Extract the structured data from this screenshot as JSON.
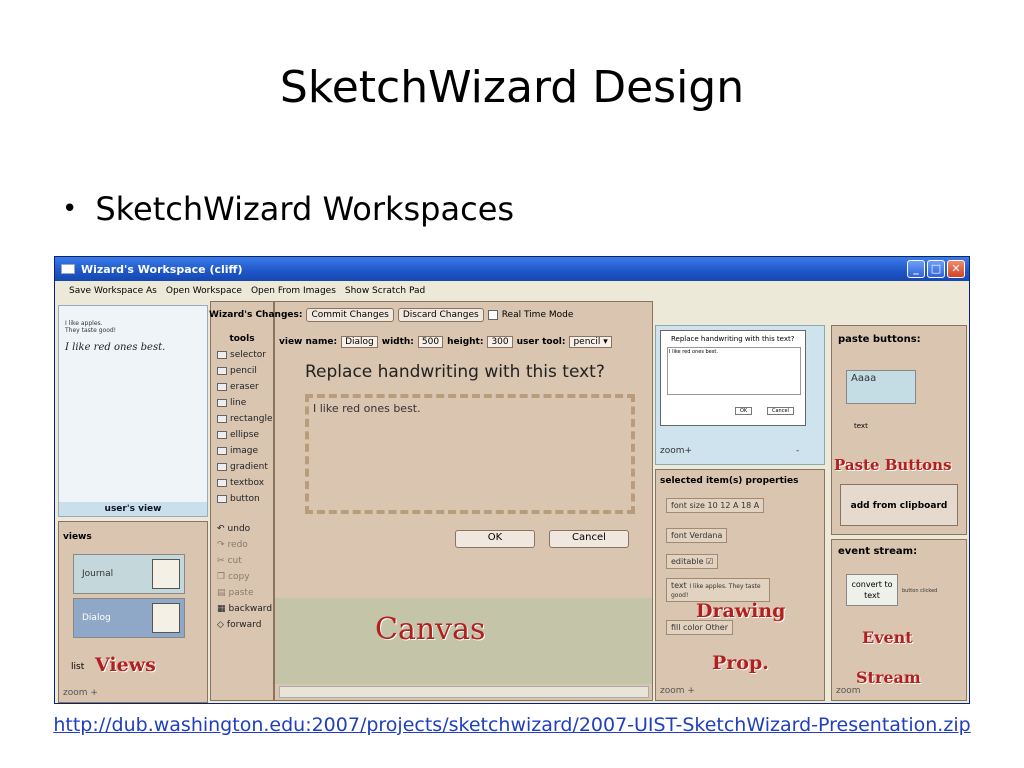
{
  "slide": {
    "title": "SketchWizard Design",
    "bullet": "SketchWizard Workspaces",
    "url": "http://dub.washington.edu:2007/projects/sketchwizard/2007-UIST-SketchWizard-Presentation.zip"
  },
  "window": {
    "title": "Wizard's Workspace (cliff)",
    "menu": [
      "Save Workspace As",
      "Open Workspace",
      "Open From Images",
      "Show Scratch Pad"
    ]
  },
  "users_view": {
    "typed_line1": "I like apples.",
    "typed_line2": "They taste good!",
    "handwriting": "I like red ones best.",
    "label": "user's view"
  },
  "views": {
    "heading": "views",
    "item1": "Journal",
    "item2": "Dialog",
    "tab": "list",
    "zoom": "zoom +",
    "overlay": "Views"
  },
  "tools": {
    "heading": "tools",
    "items": [
      "selector",
      "pencil",
      "eraser",
      "line",
      "rectangle",
      "ellipse",
      "image",
      "gradient",
      "textbox",
      "button"
    ],
    "history": [
      "undo",
      "redo",
      "cut",
      "copy",
      "paste",
      "backward",
      "forward"
    ]
  },
  "canvas": {
    "changes_label": "Wizard's Changes:",
    "commit": "Commit Changes",
    "discard": "Discard Changes",
    "realtime": "Real Time Mode",
    "view_name_label": "view name:",
    "view_name": "Dialog",
    "width_label": "width:",
    "width": "500",
    "height_label": "height:",
    "height": "300",
    "user_tool_label": "user tool:",
    "user_tool": "pencil",
    "question": "Replace handwriting with this text?",
    "answer": "I like red ones best.",
    "ok": "OK",
    "cancel": "Cancel",
    "overlay": "Canvas"
  },
  "preview": {
    "question": "Replace handwriting with this text?",
    "answer": "I like red ones best.",
    "ok": "OK",
    "cancel": "Cancel",
    "zoom": "zoom+",
    "zoom_minus": "-"
  },
  "properties": {
    "heading": "selected item(s) properties",
    "font_size_label": "font size",
    "size_small": "10",
    "size_med": "12 A",
    "size_large": "18 A",
    "font_label": "font",
    "font": "Verdana",
    "editable_label": "editable",
    "text_label": "text",
    "text_value": "I like apples. They taste good!",
    "fill_label": "fill color",
    "fill_value": "Other",
    "zoom": "zoom +",
    "overlay1": "Drawing",
    "overlay2": "Prop."
  },
  "paste": {
    "heading": "paste buttons:",
    "card": "Aaaa",
    "card_caption": "text",
    "overlay": "Paste Buttons",
    "clip": "add from clipboard"
  },
  "event": {
    "heading": "event stream:",
    "convert": "convert to text",
    "clicked": "button clicked",
    "zoom": "zoom",
    "overlay1": "Event",
    "overlay2": "Stream"
  },
  "colors": {
    "accent": "#b21f1f",
    "titlebar": "#1e56c8",
    "panel": "#d9c5b0"
  }
}
